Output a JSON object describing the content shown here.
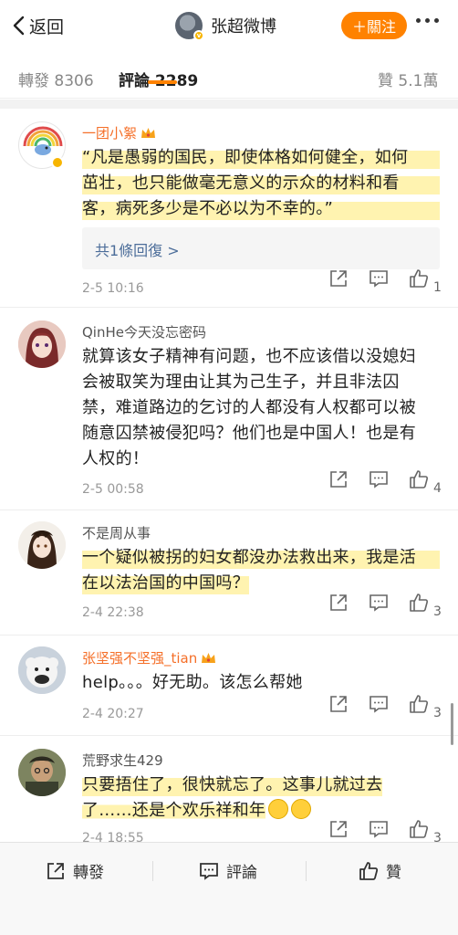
{
  "header": {
    "back_label": "返回",
    "profile_name": "张超微博",
    "follow_label": "＋關注"
  },
  "tabs": {
    "repost": "轉發 8306",
    "comments": "評論 2289",
    "likes": "贊 5.1萬"
  },
  "comments": [
    {
      "name": "一团小絮",
      "lines": [
        "“凡是愚弱的国民，即使体格如何健全，如何",
        "茁壮，也只能做毫无意义的示众的材料和看",
        "客，病死多少是不必以为不幸的。”"
      ],
      "reply_text": "共1條回復 >",
      "time": "2-5 10:16",
      "likes": "1"
    },
    {
      "name": "QinHe今天没忘密码",
      "lines": [
        "就算该女子精神有问题，也不应该借以没媳妇",
        "会被取笑为理由让其为己生子，并且非法囚",
        "禁，难道路边的乞讨的人都没有人权都可以被",
        "随意囚禁被侵犯吗？他们也是中国人！也是有",
        "人权的！"
      ],
      "time": "2-5 00:58",
      "likes": "4"
    },
    {
      "name": "不是周从事",
      "lines": [
        "一个疑似被拐的妇女都没办法救出来，我是活",
        "在以法治国的中国吗？"
      ],
      "time": "2-4 22:38",
      "likes": "3"
    },
    {
      "name": "张坚强不坚强_tian",
      "lines": [
        "help。。。好无助。该怎么帮她"
      ],
      "time": "2-4 20:27",
      "likes": "3"
    },
    {
      "name": "荒野求生429",
      "lines": [
        "只要捂住了，很快就忘了。这事儿就过去",
        "了……还是个欢乐祥和年"
      ],
      "time": "2-4 18:55",
      "likes": "3"
    }
  ],
  "bottom": {
    "repost": "轉發",
    "comment": "評論",
    "like": "贊"
  },
  "colors": {
    "accent": "#ff8200",
    "highlight": "#fff3b0",
    "vip_name": "#f56f28",
    "reply_link": "#4d6e9a"
  }
}
